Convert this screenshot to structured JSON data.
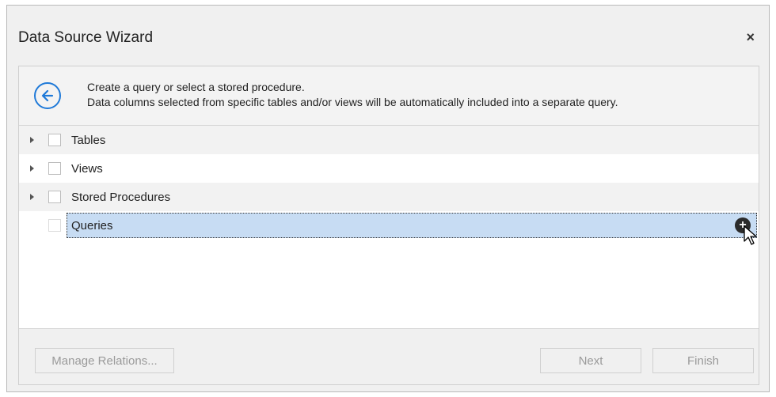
{
  "window": {
    "title": "Data Source Wizard",
    "close_label": "×"
  },
  "header": {
    "line1": "Create a query or select a stored procedure.",
    "line2": "Data columns selected from specific tables and/or views will be automatically included into a separate query."
  },
  "tree": {
    "items": [
      {
        "label": "Tables",
        "expandable": true,
        "checked": false
      },
      {
        "label": "Views",
        "expandable": true,
        "checked": false
      },
      {
        "label": "Stored Procedures",
        "expandable": true,
        "checked": false
      },
      {
        "label": "Queries",
        "expandable": false,
        "checked": false,
        "selected": true
      }
    ],
    "add_query_glyph": "+"
  },
  "footer": {
    "manage_relations_label": "Manage Relations...",
    "next_label": "Next",
    "finish_label": "Finish"
  },
  "colors": {
    "accent": "#1e79d8",
    "selection": "#c7dcf3"
  }
}
